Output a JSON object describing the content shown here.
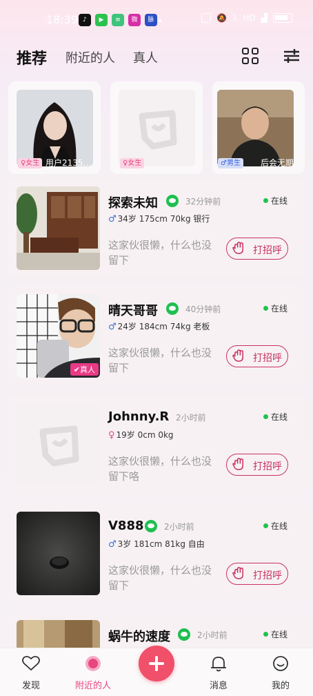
{
  "status_bar": {
    "time": "18:39",
    "apps": [
      "TikTok",
      "iQIYI",
      "Memo",
      "Weibo",
      "脉"
    ],
    "network": "HD"
  },
  "top_tabs": [
    {
      "label": "推荐",
      "active": true
    },
    {
      "label": "附近的人",
      "active": false
    },
    {
      "label": "真人",
      "active": false
    }
  ],
  "featured": [
    {
      "gender": "女生",
      "name": "用户2135..."
    },
    {
      "gender": "女生",
      "name": ""
    },
    {
      "gender": "男生",
      "name": "后会无期"
    }
  ],
  "users": [
    {
      "name": "探索未知",
      "ago": "32分钟前",
      "status": "在线",
      "gender": "male",
      "info": "34岁 175cm 70kg 银行",
      "bio": "这家伙很懒，什么也没留下",
      "button": "打招呼",
      "badge": ""
    },
    {
      "name": "晴天哥哥",
      "ago": "40分钟前",
      "status": "在线",
      "gender": "male",
      "info": "24岁 184cm 74kg 老板",
      "bio": "这家伙很懒，什么也没留下",
      "button": "打招呼",
      "badge": "真人"
    },
    {
      "name": "Johnny.R",
      "ago": "2小时前",
      "status": "在线",
      "gender": "female",
      "info": "19岁 0cm 0kg",
      "bio": "这家伙很懒，什么也没留下咯",
      "button": "打招呼",
      "badge": ""
    },
    {
      "name": "V888",
      "ago": "2小时前",
      "status": "在线",
      "gender": "male",
      "info": "3岁 181cm 81kg 自由",
      "bio": "这家伙很懒，什么也没留下",
      "button": "打招呼",
      "badge": ""
    },
    {
      "name": "蜗牛的速度",
      "ago": "2小时前",
      "status": "在线",
      "gender": "male",
      "info": "",
      "bio": "",
      "button": "",
      "badge": ""
    }
  ],
  "bottom_nav": [
    {
      "label": "发现",
      "icon": "heart-chat-icon",
      "active": false
    },
    {
      "label": "附近的人",
      "icon": "nearby-icon",
      "active": true
    },
    {
      "label": "消息",
      "icon": "bell-icon",
      "active": false
    },
    {
      "label": "我的",
      "icon": "profile-icon",
      "active": false
    }
  ],
  "colors": {
    "accent": "#e8457f",
    "online": "#1fc24d",
    "plus": "#f0506a",
    "hello": "#c8325e"
  }
}
